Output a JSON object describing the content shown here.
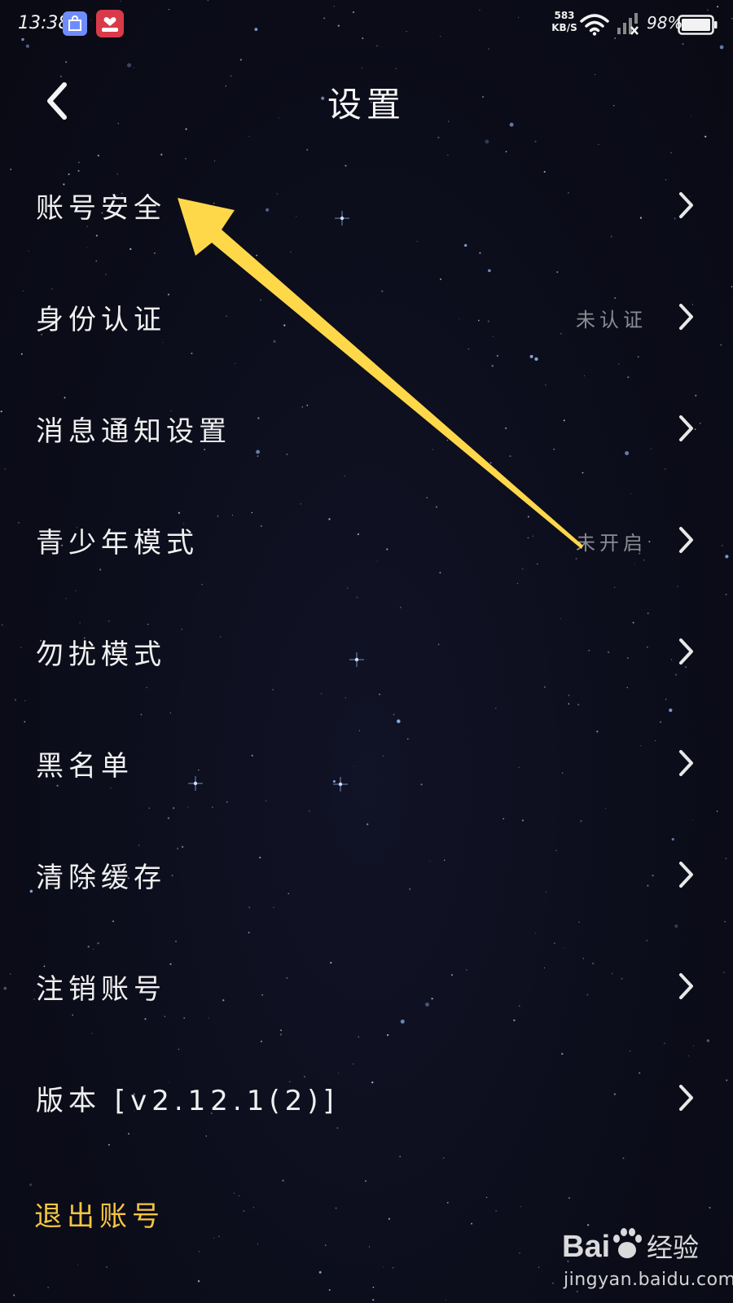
{
  "status_bar": {
    "time": "13:38",
    "net_speed_value": "583",
    "net_speed_unit": "KB/S",
    "battery_percent": "98%"
  },
  "header": {
    "title": "设置"
  },
  "settings_items": [
    {
      "label": "账号安全",
      "status": ""
    },
    {
      "label": "身份认证",
      "status": "未认证"
    },
    {
      "label": "消息通知设置",
      "status": ""
    },
    {
      "label": "青少年模式",
      "status": "未开启"
    },
    {
      "label": "勿扰模式",
      "status": ""
    },
    {
      "label": "黑名单",
      "status": ""
    },
    {
      "label": "清除缓存",
      "status": ""
    },
    {
      "label": "注销账号",
      "status": ""
    },
    {
      "label": "版本 [v2.12.1(2)]",
      "status": ""
    }
  ],
  "logout": {
    "label": "退出账号"
  },
  "watermark": {
    "logo_text": "Bai 经验",
    "url": "jingyan.baidu.com"
  },
  "colors": {
    "background": "#0c0d1a",
    "text": "#f0f0f0",
    "status_text": "#8a8c94",
    "logout": "#f5c542",
    "annotation_arrow": "#ffd84a"
  },
  "icons": {
    "back": "chevron-left-icon",
    "item_arrow": "chevron-right-icon",
    "wifi": "wifi-icon",
    "signal": "signal-icon",
    "battery": "battery-icon"
  }
}
